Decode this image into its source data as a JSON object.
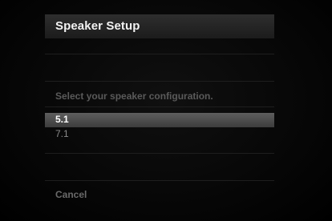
{
  "dialog": {
    "title": "Speaker Setup",
    "prompt": "Select your speaker configuration.",
    "options": [
      {
        "label": "5.1",
        "selected": true
      },
      {
        "label": "7.1",
        "selected": false
      }
    ],
    "cancel_label": "Cancel"
  },
  "colors": {
    "background": "#060606",
    "title_bar": "#262626",
    "selected_row": "#4a4a4a",
    "title_text": "#f2f2f2",
    "muted_text": "#5a5a5a"
  }
}
